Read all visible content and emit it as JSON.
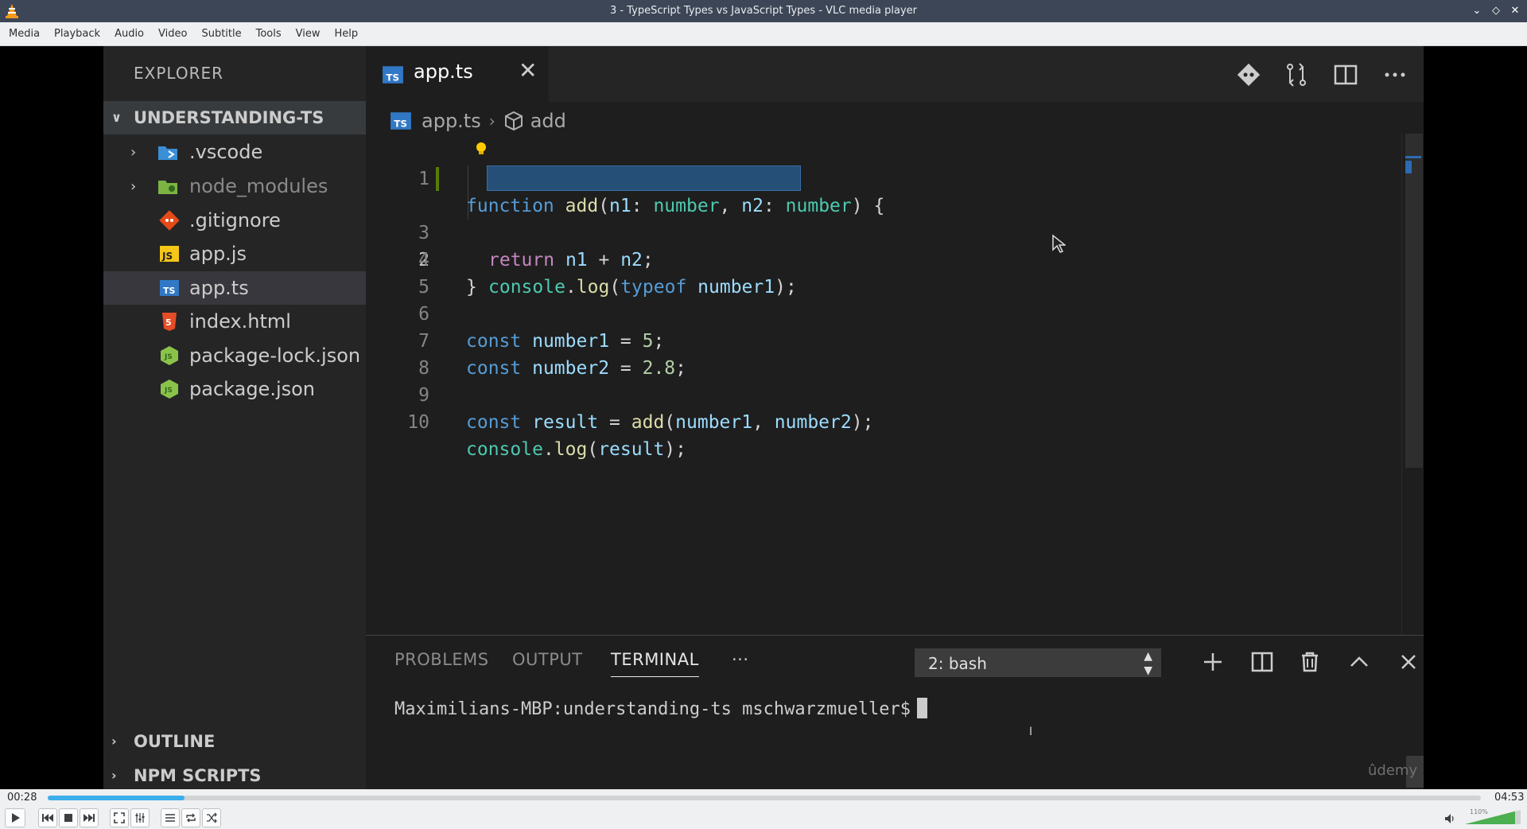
{
  "window": {
    "title": "3 - TypeScript Types vs JavaScript Types - VLC media player"
  },
  "menu": [
    "Media",
    "Playback",
    "Audio",
    "Video",
    "Subtitle",
    "Tools",
    "View",
    "Help"
  ],
  "vscode": {
    "sidebar": {
      "title": "EXPLORER",
      "project": "UNDERSTANDING-TS",
      "items": [
        {
          "name": ".vscode",
          "kind": "folder",
          "icon": "vscode-folder-icon"
        },
        {
          "name": "node_modules",
          "kind": "folder",
          "icon": "node-folder-icon"
        },
        {
          "name": ".gitignore",
          "kind": "file",
          "icon": "git-icon"
        },
        {
          "name": "app.js",
          "kind": "file",
          "icon": "js-file-icon"
        },
        {
          "name": "app.ts",
          "kind": "file",
          "icon": "ts-file-icon",
          "selected": true
        },
        {
          "name": "index.html",
          "kind": "file",
          "icon": "html-file-icon"
        },
        {
          "name": "package-lock.json",
          "kind": "file",
          "icon": "nodejs-icon"
        },
        {
          "name": "package.json",
          "kind": "file",
          "icon": "nodejs-icon"
        }
      ],
      "outline": "OUTLINE",
      "npm_scripts": "NPM SCRIPTS"
    },
    "tab": {
      "label": "app.ts",
      "close": "✕"
    },
    "breadcrumb": {
      "file": "app.ts",
      "symbol": "add"
    },
    "code": {
      "line_numbers": [
        "1",
        "2",
        "3",
        "4",
        "5",
        "6",
        "7",
        "8",
        "9",
        "10"
      ],
      "active_line": "2",
      "l1": {
        "kw": "function",
        "sp1": " ",
        "fn": "add",
        "p1": "(",
        "a": "n1",
        "c1": ": ",
        "t1": "number",
        "cm": ", ",
        "b": "n2",
        "c2": ": ",
        "t2": "number",
        "p2": ") {"
      },
      "l2": {
        "obj": "console",
        "dot": ".",
        "fn": "log",
        "p1": "(",
        "kw": "typeof",
        "sp": " ",
        "v": "number1",
        "p2": ");"
      },
      "l3": {
        "kw": "return",
        "rest1": " ",
        "a": "n1",
        "op": " + ",
        "b": "n2",
        "end": ";"
      },
      "l4": "}",
      "l6": {
        "kw": "const",
        "sp": " ",
        "v": "number1",
        "eq": " = ",
        "num": "5",
        "end": ";"
      },
      "l7": {
        "kw": "const",
        "sp": " ",
        "v": "number2",
        "eq": " = ",
        "num": "2.8",
        "end": ";"
      },
      "l9": {
        "kw": "const",
        "sp": " ",
        "v": "result",
        "eq": " = ",
        "fn": "add",
        "p1": "(",
        "a": "number1",
        "cm": ", ",
        "b": "number2",
        "p2": ");"
      },
      "l10": {
        "obj": "console",
        "dot": ".",
        "fn": "log",
        "p1": "(",
        "v": "result",
        "p2": ");"
      }
    },
    "panel": {
      "tabs": [
        "PROBLEMS",
        "OUTPUT",
        "TERMINAL",
        "···"
      ],
      "active_tab": "TERMINAL",
      "terminal_select": "2: bash",
      "prompt": "Maximilians-MBP:understanding-ts mschwarzmueller$"
    },
    "watermark": "ûdemy"
  },
  "player": {
    "elapsed": "00:28",
    "total": "04:53",
    "progress_fraction": 0.0956,
    "volume_label": "110%",
    "volume_fraction": 0.9,
    "accent": "#3daee9"
  }
}
